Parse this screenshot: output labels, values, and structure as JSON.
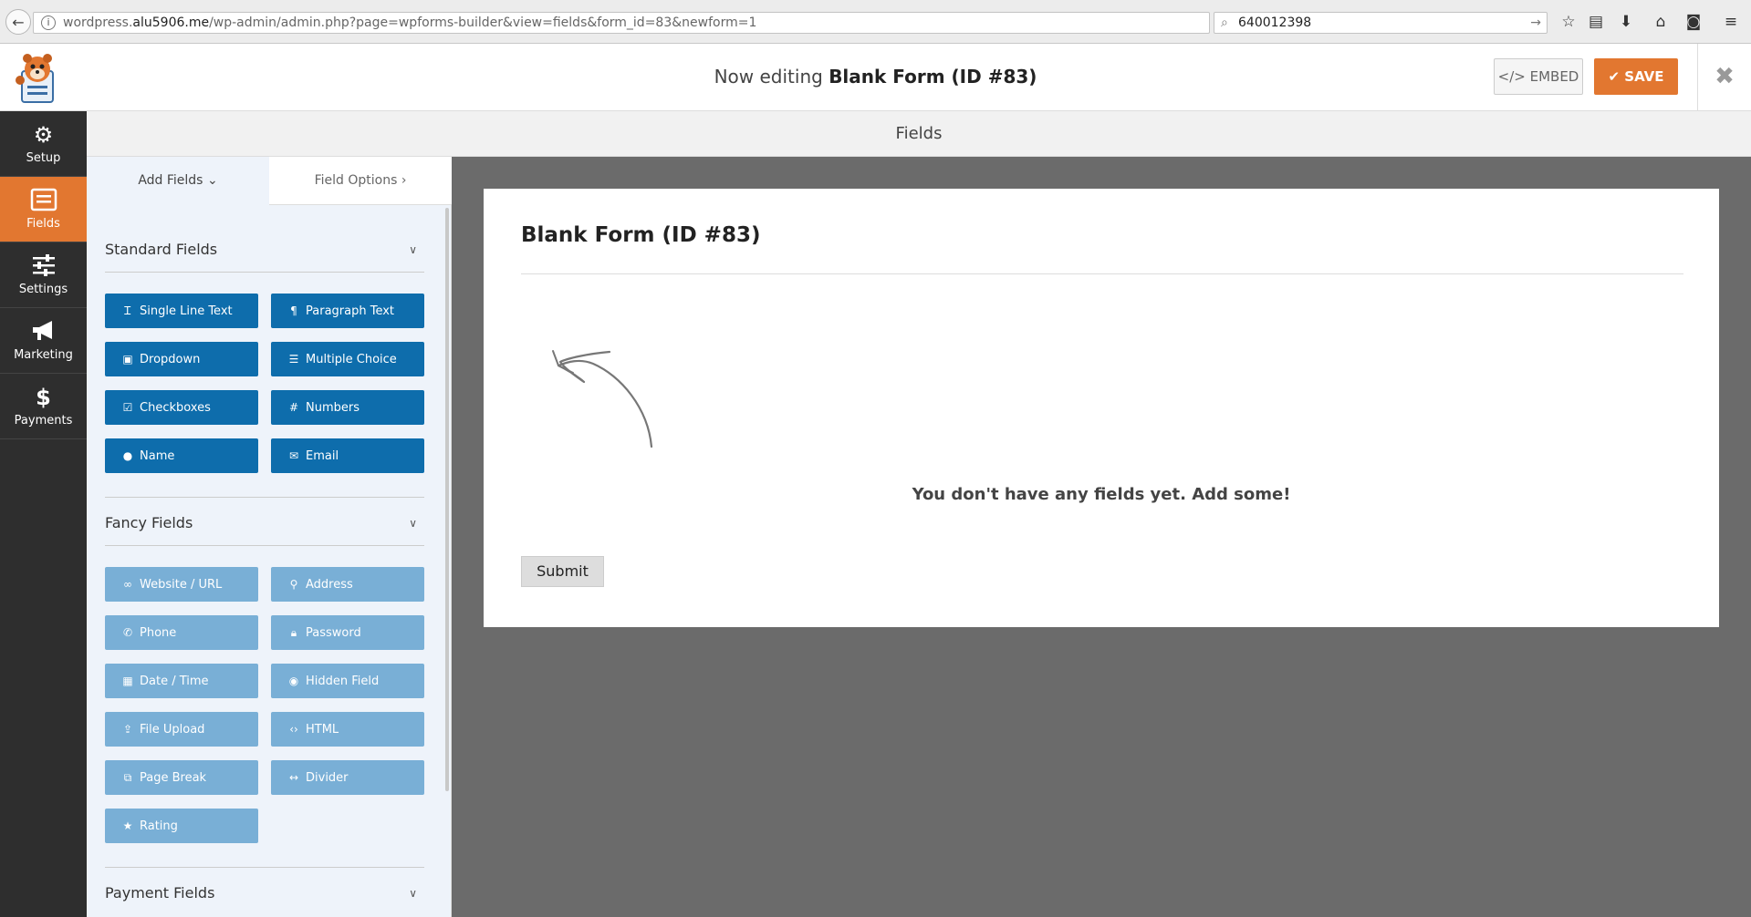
{
  "browser": {
    "back_glyph": "←",
    "url_prefix": "wordpress.",
    "url_host": "alu5906.me",
    "url_path": "/wp-admin/admin.php?page=wpforms-builder&view=fields&form_id=83&newform=1",
    "search_value": "640012398",
    "toolbar_icons": [
      "star-icon",
      "reading-list-icon",
      "download-icon",
      "home-icon",
      "pocket-icon",
      "menu-icon"
    ]
  },
  "header": {
    "editing_prefix": "Now editing",
    "form_name": "Blank Form (ID #83)",
    "embed_label": "EMBED",
    "save_label": "SAVE"
  },
  "side_nav": [
    {
      "label": "Setup",
      "icon": "gear-icon",
      "active": false
    },
    {
      "label": "Fields",
      "icon": "list-icon",
      "active": true
    },
    {
      "label": "Settings",
      "icon": "sliders-icon",
      "active": false
    },
    {
      "label": "Marketing",
      "icon": "megaphone-icon",
      "active": false
    },
    {
      "label": "Payments",
      "icon": "dollar-icon",
      "active": false
    }
  ],
  "fields_bar": {
    "title": "Fields"
  },
  "panel": {
    "tab_add": "Add Fields",
    "tab_options": "Field Options",
    "standard": {
      "title": "Standard Fields",
      "buttons": [
        "Single Line Text",
        "Paragraph Text",
        "Dropdown",
        "Multiple Choice",
        "Checkboxes",
        "Numbers",
        "Name",
        "Email"
      ]
    },
    "fancy": {
      "title": "Fancy Fields",
      "buttons": [
        "Website / URL",
        "Address",
        "Phone",
        "Password",
        "Date / Time",
        "Hidden Field",
        "File Upload",
        "HTML",
        "Page Break",
        "Divider",
        "Rating"
      ]
    },
    "payment": {
      "title": "Payment Fields"
    }
  },
  "preview": {
    "form_title": "Blank Form (ID #83)",
    "empty_message": "You don't have any fields yet. Add some!",
    "submit_label": "Submit"
  },
  "colors": {
    "accent": "#e27730",
    "standard_btn": "#0e6dac",
    "fancy_btn": "#79afd6",
    "nav_bg": "#2e2e2e"
  }
}
